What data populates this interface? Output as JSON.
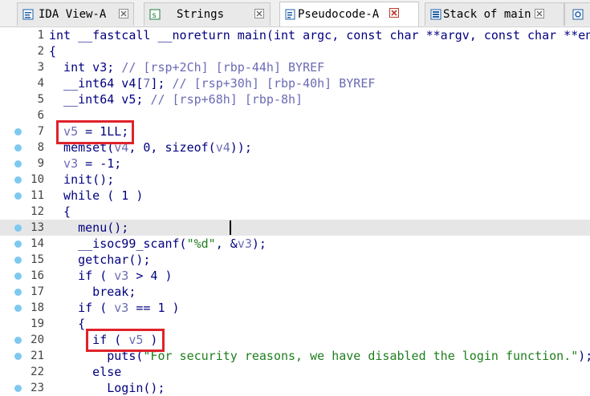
{
  "tabs": [
    {
      "label": "IDA View-A",
      "icon": "ida-view-icon",
      "active": false
    },
    {
      "label": "Strings",
      "icon": "strings-icon",
      "active": false
    },
    {
      "label": "Pseudocode-A",
      "icon": "pseudocode-icon",
      "active": true
    },
    {
      "label": "Stack of main",
      "icon": "stack-icon",
      "active": false
    },
    {
      "label": "",
      "icon": "structures-icon",
      "active": false
    }
  ],
  "code": {
    "lines": [
      {
        "n": "1",
        "bp": false,
        "segs": [
          [
            "def",
            "int __fastcall __noreturn main(int argc, const char **argv, const char **en"
          ]
        ]
      },
      {
        "n": "2",
        "bp": false,
        "segs": [
          [
            "def",
            "{"
          ]
        ]
      },
      {
        "n": "3",
        "bp": false,
        "segs": [
          [
            "def",
            "  int v3; "
          ],
          [
            "cmt",
            "// [rsp+2Ch] [rbp-44h] BYREF"
          ]
        ]
      },
      {
        "n": "4",
        "bp": false,
        "segs": [
          [
            "def",
            "  __int64 v4["
          ],
          [
            "var",
            "7"
          ],
          [
            "def",
            "]; "
          ],
          [
            "cmt",
            "// [rsp+30h] [rbp-40h] BYREF"
          ]
        ]
      },
      {
        "n": "5",
        "bp": false,
        "segs": [
          [
            "def",
            "  __int64 v5; "
          ],
          [
            "cmt",
            "// [rsp+68h] [rbp-8h]"
          ]
        ]
      },
      {
        "n": "6",
        "bp": false,
        "segs": [
          [
            "def",
            ""
          ]
        ]
      },
      {
        "n": "7",
        "bp": true,
        "segs": [
          [
            "var",
            "  v5"
          ],
          [
            "def",
            " = 1LL;"
          ]
        ]
      },
      {
        "n": "8",
        "bp": true,
        "segs": [
          [
            "def",
            "  memset("
          ],
          [
            "var",
            "v4"
          ],
          [
            "def",
            ", 0, sizeof("
          ],
          [
            "var",
            "v4"
          ],
          [
            "def",
            "));"
          ]
        ]
      },
      {
        "n": "9",
        "bp": true,
        "segs": [
          [
            "var",
            "  v3"
          ],
          [
            "def",
            " = -1;"
          ]
        ]
      },
      {
        "n": "10",
        "bp": true,
        "segs": [
          [
            "def",
            "  init();"
          ]
        ]
      },
      {
        "n": "11",
        "bp": true,
        "segs": [
          [
            "def",
            "  while ( 1 )"
          ]
        ]
      },
      {
        "n": "12",
        "bp": false,
        "segs": [
          [
            "def",
            "  {"
          ]
        ]
      },
      {
        "n": "13",
        "bp": true,
        "segs": [
          [
            "def",
            "    menu();"
          ]
        ]
      },
      {
        "n": "14",
        "bp": true,
        "segs": [
          [
            "def",
            "    __isoc99_scanf("
          ],
          [
            "str",
            "\"%d\""
          ],
          [
            "def",
            ", &"
          ],
          [
            "var",
            "v3"
          ],
          [
            "def",
            ");"
          ]
        ]
      },
      {
        "n": "15",
        "bp": true,
        "segs": [
          [
            "def",
            "    getchar();"
          ]
        ]
      },
      {
        "n": "16",
        "bp": true,
        "segs": [
          [
            "def",
            "    if ( "
          ],
          [
            "var",
            "v3"
          ],
          [
            "def",
            " > 4 )"
          ]
        ]
      },
      {
        "n": "17",
        "bp": true,
        "segs": [
          [
            "def",
            "      break;"
          ]
        ]
      },
      {
        "n": "18",
        "bp": true,
        "segs": [
          [
            "def",
            "    if ( "
          ],
          [
            "var",
            "v3"
          ],
          [
            "def",
            " == 1 )"
          ]
        ]
      },
      {
        "n": "19",
        "bp": false,
        "segs": [
          [
            "def",
            "    {"
          ]
        ]
      },
      {
        "n": "20",
        "bp": true,
        "segs": [
          [
            "def",
            "      if ( "
          ],
          [
            "var",
            "v5"
          ],
          [
            "def",
            " )"
          ]
        ]
      },
      {
        "n": "21",
        "bp": true,
        "segs": [
          [
            "def",
            "        puts("
          ],
          [
            "str",
            "\"For security reasons, we have disabled the login function.\""
          ],
          [
            "def",
            ");"
          ]
        ]
      },
      {
        "n": "22",
        "bp": false,
        "segs": [
          [
            "def",
            "      else"
          ]
        ]
      },
      {
        "n": "23",
        "bp": true,
        "segs": [
          [
            "def",
            "        Login();"
          ]
        ]
      }
    ],
    "highlighted_line": "13"
  },
  "colors": {
    "keyword": "#000080",
    "variable": "#6b6bb5",
    "string": "#1e7e1e",
    "annotation_box": "#e0222a",
    "breakpoint_dot": "#7fc8f0"
  }
}
